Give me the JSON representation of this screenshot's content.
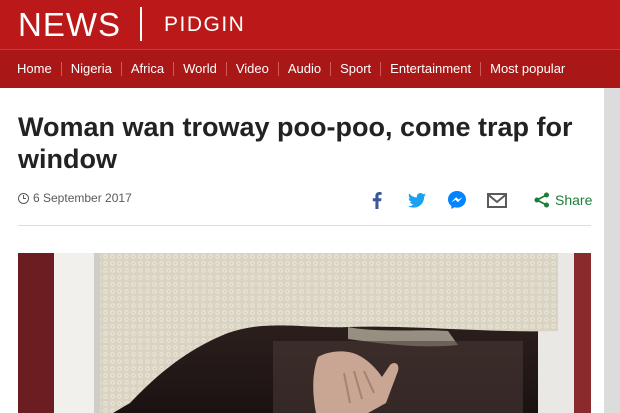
{
  "brand": {
    "name": "NEWS",
    "section": "PIDGIN"
  },
  "nav": {
    "items": [
      "Home",
      "Nigeria",
      "Africa",
      "World",
      "Video",
      "Audio",
      "Sport",
      "Entertainment",
      "Most popular"
    ]
  },
  "article": {
    "headline": "Woman wan troway poo-poo, come trap for window",
    "date": "6 September 2017",
    "share_label": "Share"
  },
  "share_icons": [
    "facebook-icon",
    "twitter-icon",
    "messenger-icon",
    "email-icon",
    "share-icon"
  ],
  "colors": {
    "brand_red": "#bb1919",
    "nav_red": "#a91717",
    "facebook": "#3b5998",
    "twitter": "#1da1f2",
    "messenger": "#0084ff",
    "email": "#5a5a5a",
    "share": "#1a7f37"
  }
}
